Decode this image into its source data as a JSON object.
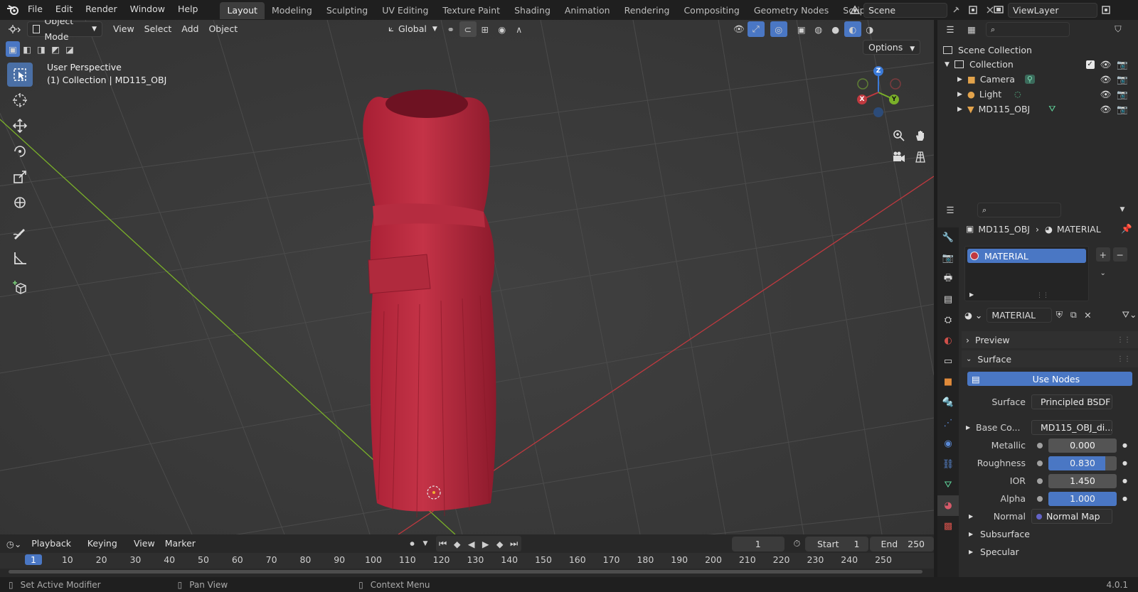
{
  "topbar": {
    "menus": [
      "File",
      "Edit",
      "Render",
      "Window",
      "Help"
    ],
    "workspaces": [
      "Layout",
      "Modeling",
      "Sculpting",
      "UV Editing",
      "Texture Paint",
      "Shading",
      "Animation",
      "Rendering",
      "Compositing",
      "Geometry Nodes",
      "Scripting"
    ],
    "active_workspace": "Layout",
    "scene": "Scene",
    "view_layer": "ViewLayer",
    "add_label": "+"
  },
  "viewport": {
    "mode": "Object Mode",
    "menus": [
      "View",
      "Select",
      "Add",
      "Object"
    ],
    "transform_orientation": "Global",
    "options_label": "Options",
    "info_line1": "User Perspective",
    "info_line2": "(1) Collection | MD115_OBJ",
    "gizmo": {
      "x": "X",
      "y": "Y",
      "z": "Z"
    }
  },
  "outliner": {
    "root": "Scene Collection",
    "collection": "Collection",
    "items": [
      {
        "name": "Camera"
      },
      {
        "name": "Light"
      },
      {
        "name": "MD115_OBJ"
      }
    ]
  },
  "properties": {
    "breadcrumb_object": "MD115_OBJ",
    "breadcrumb_material": "MATERIAL",
    "slot_name": "MATERIAL",
    "material_name": "MATERIAL",
    "preview_label": "Preview",
    "surface_section": "Surface",
    "use_nodes_label": "Use Nodes",
    "rows": [
      {
        "label": "Surface",
        "kind": "link",
        "value": "Principled BSDF",
        "socket": "#39c46b",
        "expander": false
      },
      {
        "label": "Base Co...",
        "kind": "link",
        "value": "MD115_OBJ_di...",
        "socket": "#c7c729",
        "expander": true
      },
      {
        "label": "Metallic",
        "kind": "slider",
        "value": "0.000",
        "fill": 0.0,
        "socket": "#a1a1a1",
        "expander": false
      },
      {
        "label": "Roughness",
        "kind": "slider",
        "value": "0.830",
        "fill": 0.83,
        "socket": "#a1a1a1",
        "expander": false
      },
      {
        "label": "IOR",
        "kind": "slider",
        "value": "1.450",
        "fill": 0.0,
        "socket": "#a1a1a1",
        "expander": false
      },
      {
        "label": "Alpha",
        "kind": "slider",
        "value": "1.000",
        "fill": 1.0,
        "socket": "#a1a1a1",
        "expander": false
      },
      {
        "label": "Normal",
        "kind": "link",
        "value": "Normal Map",
        "socket": "#6363c7",
        "expander": true
      }
    ],
    "subsections": [
      "Subsurface",
      "Specular"
    ]
  },
  "timeline": {
    "menus": [
      "Playback",
      "Keying",
      "View",
      "Marker"
    ],
    "current_frame": "1",
    "start_label": "Start",
    "start": "1",
    "end_label": "End",
    "end": "250",
    "ruler": [
      "1",
      "10",
      "20",
      "30",
      "40",
      "50",
      "60",
      "70",
      "80",
      "90",
      "100",
      "110",
      "120",
      "130",
      "140",
      "150",
      "160",
      "170",
      "180",
      "190",
      "200",
      "210",
      "220",
      "230",
      "240",
      "250"
    ]
  },
  "statusbar": {
    "left": "Set Active Modifier",
    "middle": "Pan View",
    "right": "Context Menu",
    "version": "4.0.1"
  },
  "colors": {
    "accent": "#4a77c4",
    "dress": "#b82a3e",
    "x_axis": "#c0393f",
    "y_axis": "#7ab029"
  }
}
